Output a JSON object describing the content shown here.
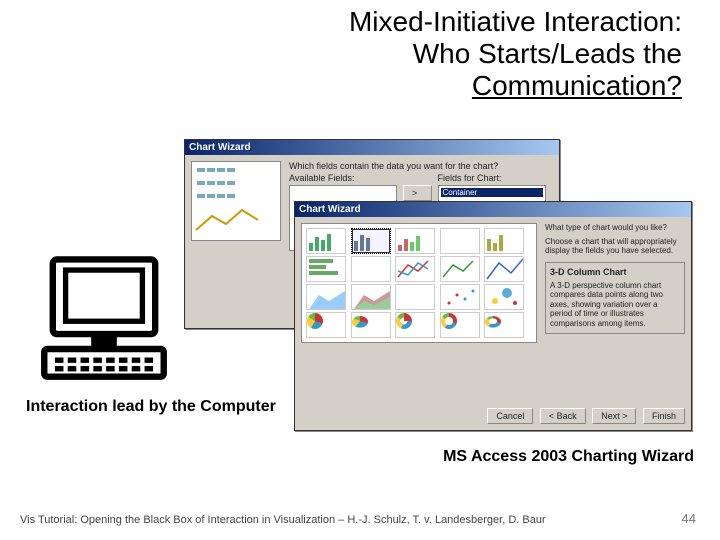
{
  "title_line1": "Mixed-Initiative Interaction:",
  "title_line2": "Who Starts/Leads the",
  "title_line3": "Communication?",
  "caption_interaction": "Interaction lead by the Computer",
  "caption_wizard": "MS Access 2003 Charting Wizard",
  "footer_text": "Vis Tutorial: Opening the Black Box of Interaction in Visualization – H.-J. Schulz, T. v. Landesberger, D. Baur",
  "page_number": "44",
  "wizard_back": {
    "title": "Chart Wizard",
    "prompt": "Which fields contain the data you want for the chart?",
    "available_label": "Available Fields:",
    "chart_fields_label": "Fields for Chart:",
    "selected_field": "Container"
  },
  "wizard_front": {
    "title": "Chart Wizard",
    "question": "What type of chart would you like?",
    "hint": "Choose a chart that will appropriately display the fields you have selected.",
    "info_title": "3-D Column Chart",
    "info_body": "A 3-D perspective column chart compares data points along two axes, showing variation over a period of time or illustrates comparisons among items.",
    "buttons": {
      "cancel": "Cancel",
      "back": "< Back",
      "next": "Next >",
      "finish": "Finish"
    }
  }
}
